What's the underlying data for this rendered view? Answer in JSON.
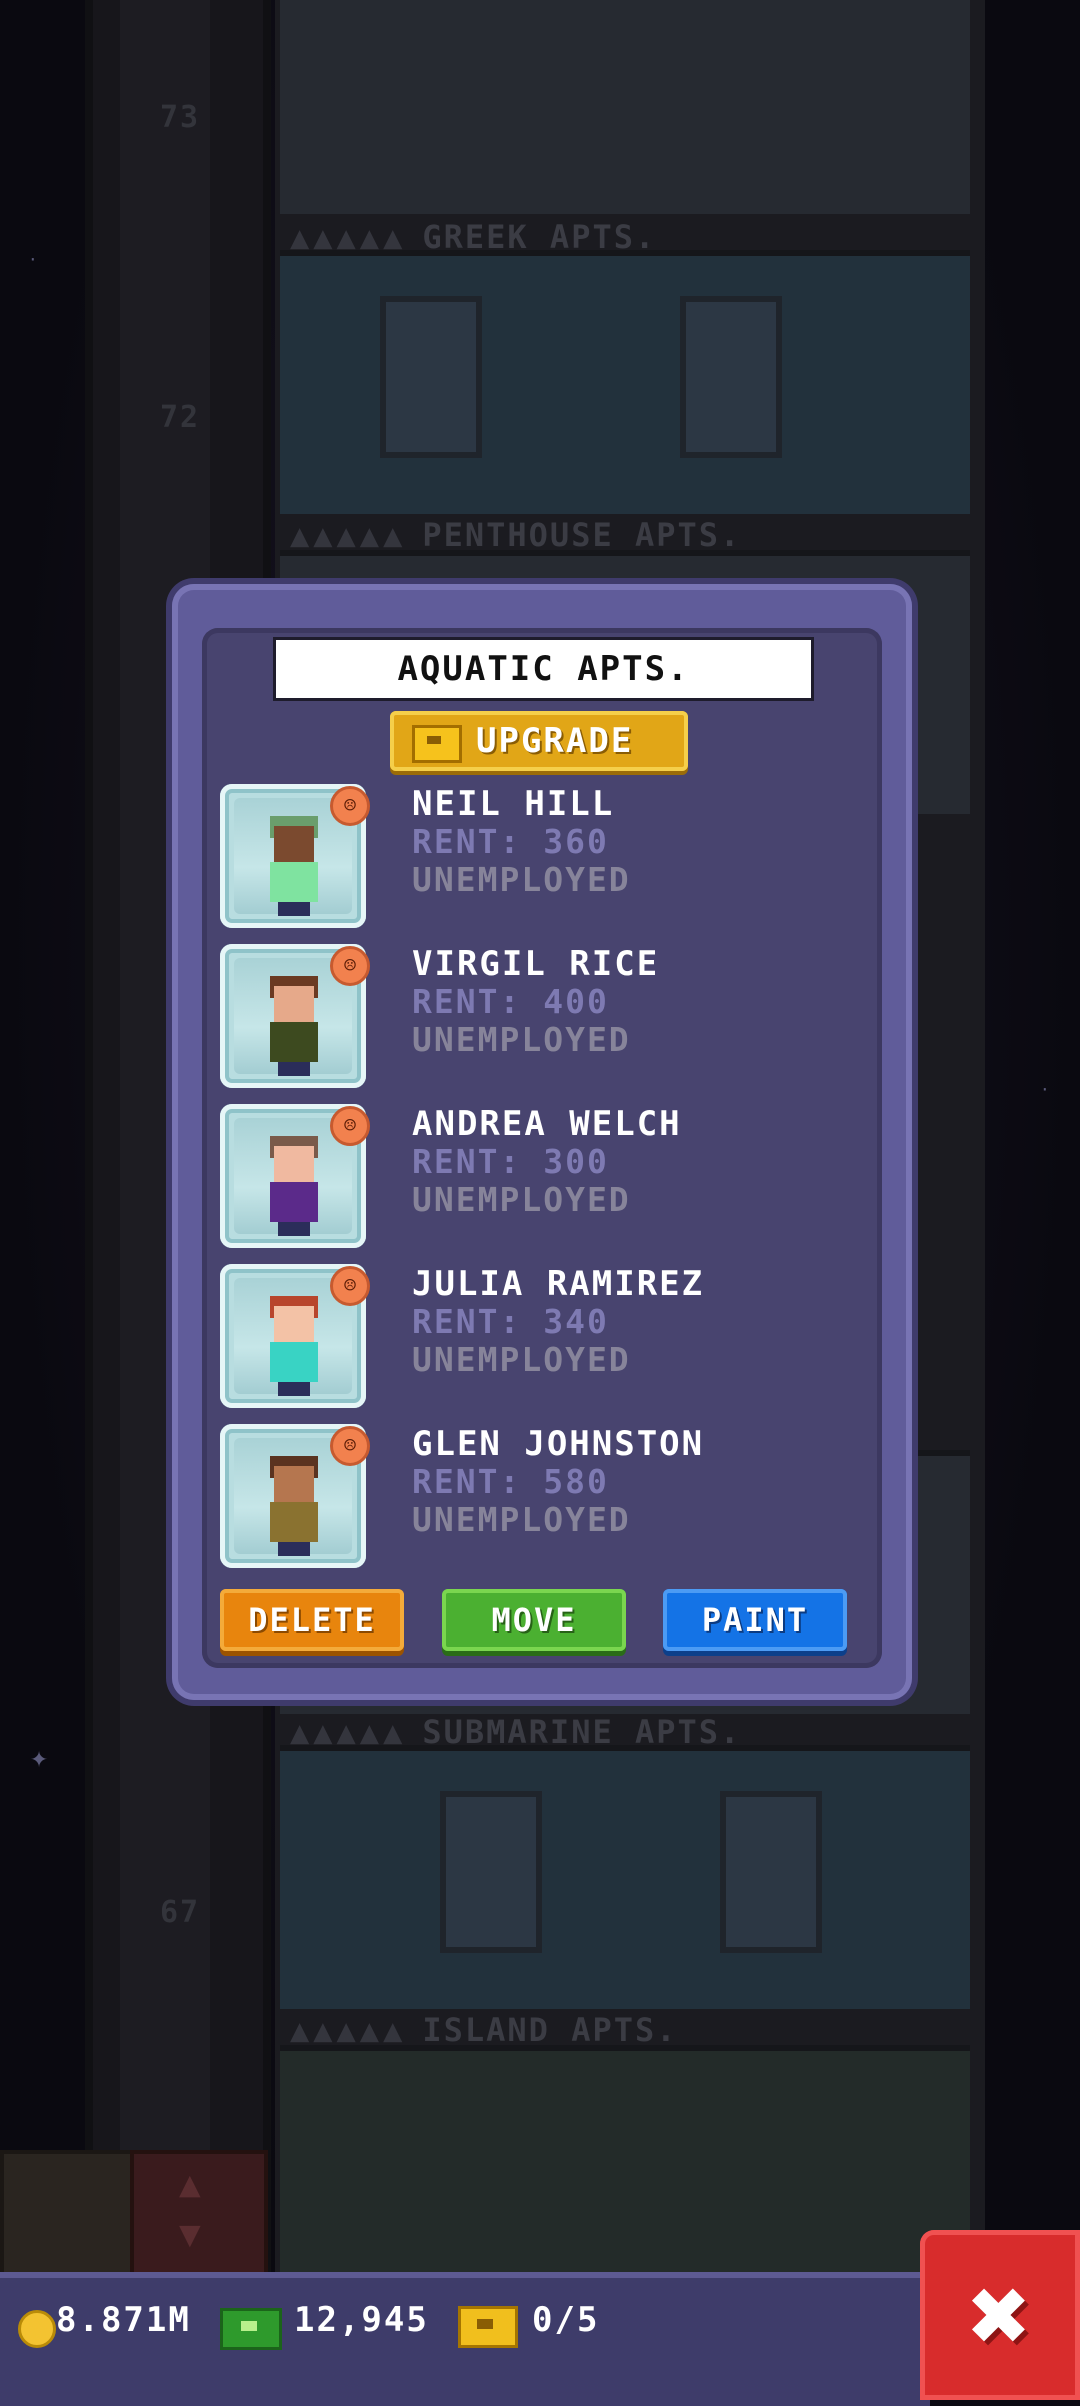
{
  "background": {
    "floor_labels": [
      "GREEK APTS.",
      "PENTHOUSE APTS.",
      "SUBMARINE APTS.",
      "ISLAND APTS."
    ],
    "floor_numbers": [
      "73",
      "72",
      "67"
    ]
  },
  "dialog": {
    "title": "AQUATIC APTS.",
    "upgrade_label": "UPGRADE",
    "tenants": [
      {
        "name": "NEIL HILL",
        "rent": "RENT: 360",
        "job": "UNEMPLOYED",
        "mood": "unhappy",
        "hair": "#6a9e6c",
        "skin": "#7b4a2f",
        "shirt": "#7fe3a0"
      },
      {
        "name": "VIRGIL RICE",
        "rent": "RENT: 400",
        "job": "UNEMPLOYED",
        "mood": "unhappy",
        "hair": "#6b3a22",
        "skin": "#e6a98a",
        "shirt": "#3d4a1f"
      },
      {
        "name": "ANDREA WELCH",
        "rent": "RENT: 300",
        "job": "UNEMPLOYED",
        "mood": "unhappy",
        "hair": "#7a5a4a",
        "skin": "#f0b9a0",
        "shirt": "#5b2a8a"
      },
      {
        "name": "JULIA RAMIREZ",
        "rent": "RENT: 340",
        "job": "UNEMPLOYED",
        "mood": "unhappy",
        "hair": "#b8452c",
        "skin": "#f3c2a6",
        "shirt": "#39d3c4"
      },
      {
        "name": "GLEN JOHNSTON",
        "rent": "RENT: 580",
        "job": "UNEMPLOYED",
        "mood": "unhappy",
        "hair": "#5a3320",
        "skin": "#b5764f",
        "shirt": "#8a7230"
      }
    ],
    "buttons": {
      "delete": "DELETE",
      "move": "MOVE",
      "paint": "PAINT"
    }
  },
  "bottom_bar": {
    "coins": "8.871M",
    "bux": "12,945",
    "vip": "0/5"
  },
  "colors": {
    "dialog_frame": "#605c9a",
    "dialog_inner": "#48446f",
    "delete": "#e8850d",
    "move": "#4bb031",
    "paint": "#1473e6",
    "close": "#d82c2c"
  }
}
